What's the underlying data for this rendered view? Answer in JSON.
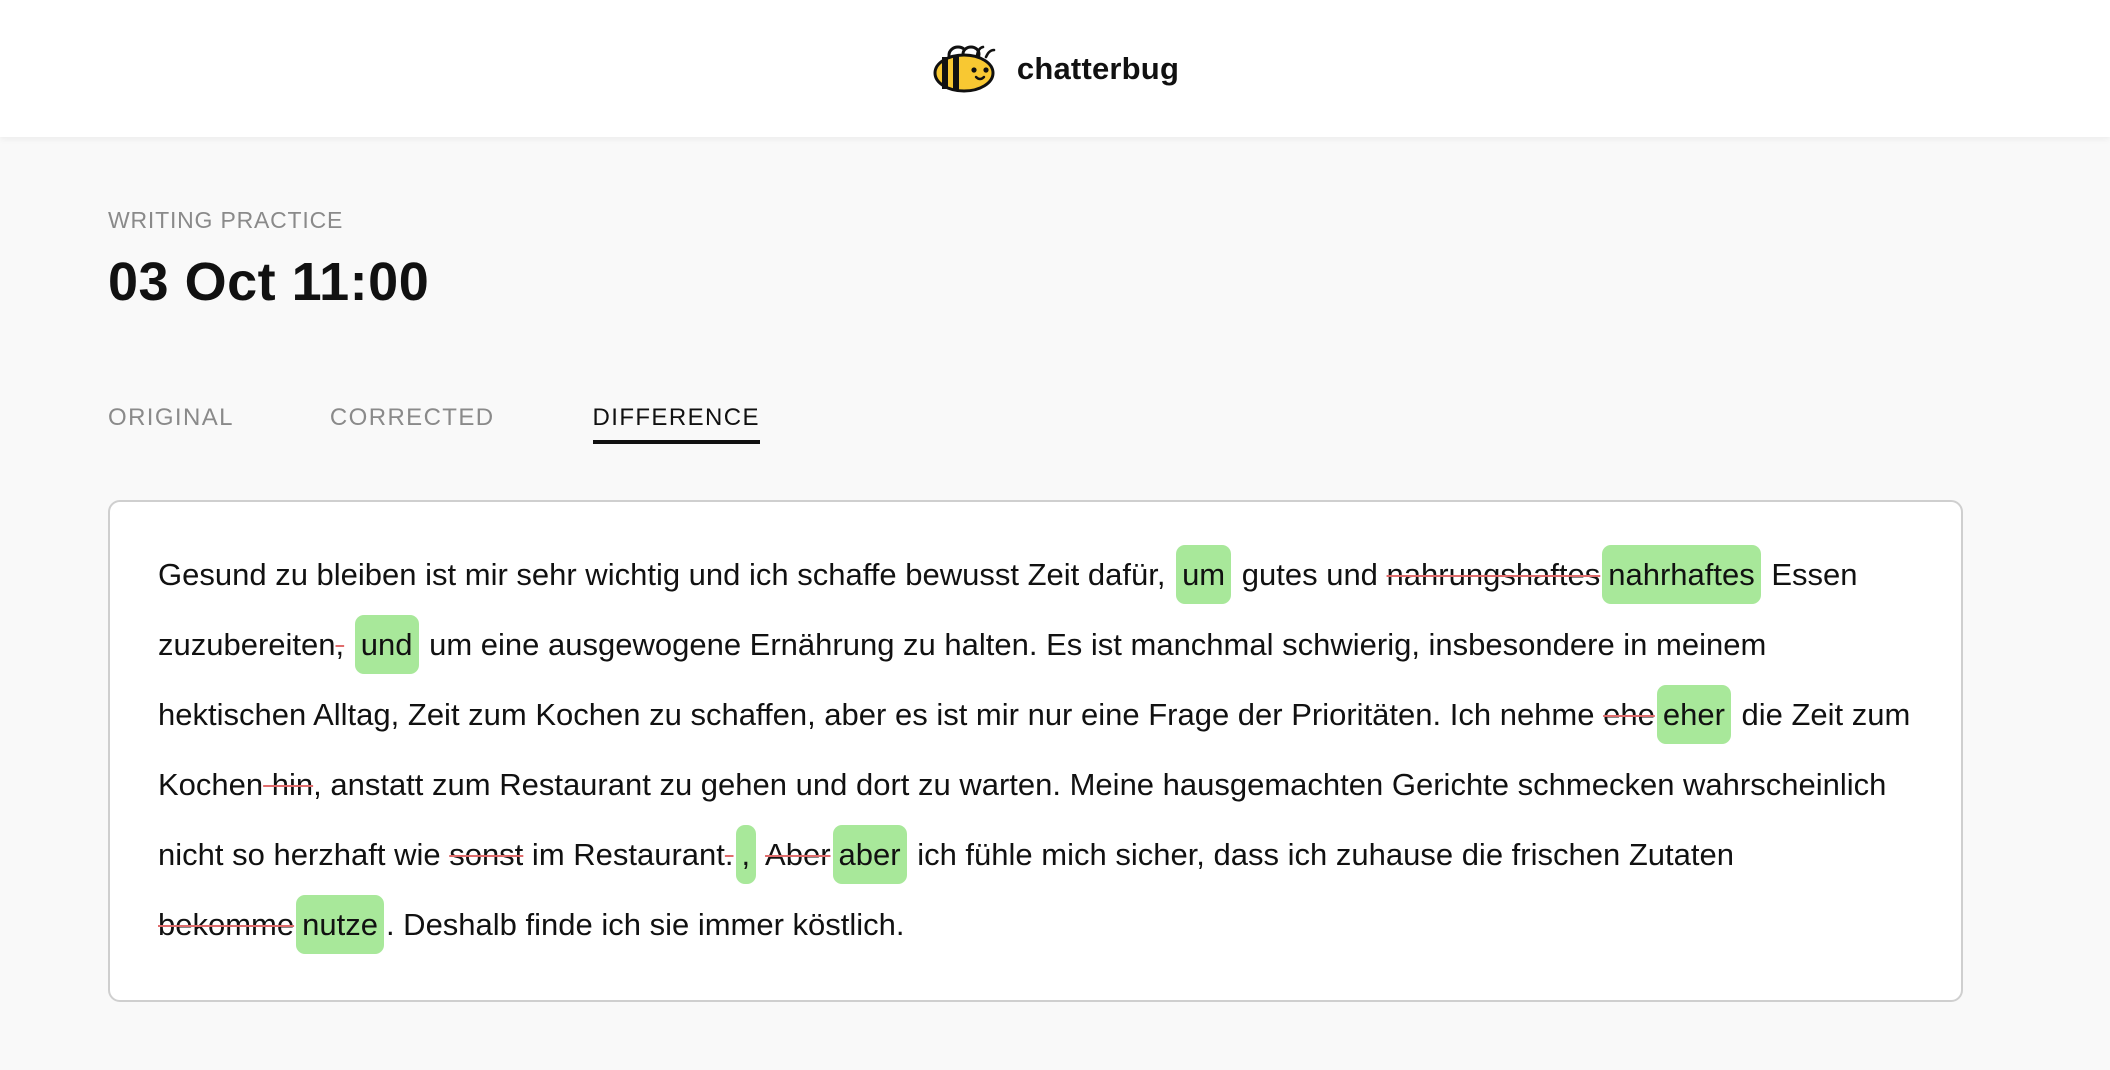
{
  "brand": {
    "name": "chatterbug",
    "logo_icon": "bee-icon",
    "accent": "#f8c832"
  },
  "header": {
    "eyebrow": "WRITING PRACTICE",
    "title": "03 Oct 11:00"
  },
  "tabs": [
    {
      "label": "ORIGINAL"
    },
    {
      "label": "CORRECTED"
    },
    {
      "label": "DIFFERENCE"
    }
  ],
  "active_tab": "DIFFERENCE",
  "colors": {
    "insert_highlight": "#a8e89a",
    "delete_strike": "#e06c6c"
  },
  "diff": {
    "s1": "Gesund zu bleiben ist mir sehr wichtig und ich schaffe bewusst Zeit dafür, ",
    "i1": "um",
    "s2": " gutes und ",
    "d1": "nahrungshaftes",
    "i2": "nahrhaftes",
    "s3": " Essen zuzubereiten",
    "d2": ",",
    "i3": "und",
    "s4": " um eine ausgewogene Ernährung zu halten. Es ist manchmal schwierig, insbesondere in meinem hektischen Alltag, Zeit zum Kochen zu schaffen, aber es ist mir nur eine Frage der Prioritäten. Ich nehme ",
    "d3": "ehe",
    "i4": "eher",
    "s5": " die Zeit zum Kochen",
    "d4": " hin",
    "s6": ", anstatt zum Restaurant zu gehen und dort zu warten. Meine hausgemachten Gerichte schmecken wahrscheinlich nicht so herzhaft wie ",
    "d5": "sonst",
    "s7": " im Restaurant",
    "d6": ".",
    "i5": ",",
    "s8": " ",
    "d7": "Aber",
    "i6": "aber",
    "s9": " ich fühle mich sicher, dass ich zuhause die frischen Zutaten ",
    "d8": "bekomme",
    "i7": "nutze",
    "s10": ". Deshalb finde ich sie immer köstlich."
  }
}
